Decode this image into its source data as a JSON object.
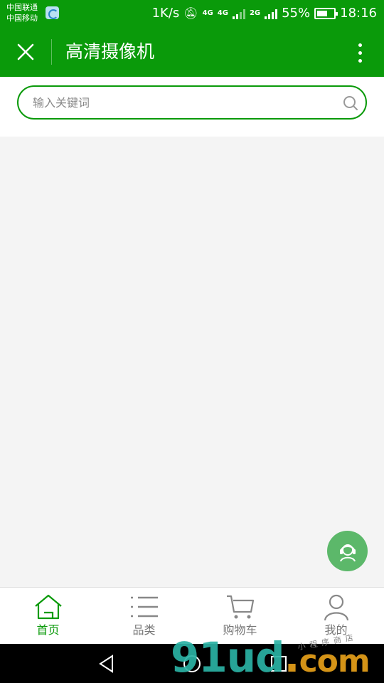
{
  "status_bar": {
    "carrier_1": "中国联通",
    "carrier_2": "中国移动",
    "speed": "1K/s",
    "network_1": "4G",
    "network_2": "4G",
    "network_3": "2G",
    "battery": "55%",
    "time": "18:16"
  },
  "header": {
    "title": "高清摄像机",
    "close_icon": "close-icon",
    "more_icon": "more-vertical-icon",
    "background": "#0a9a0a"
  },
  "search": {
    "placeholder": "输入关键词",
    "value": "",
    "icon": "search-icon"
  },
  "bottom_nav": {
    "items": [
      {
        "label": "首页",
        "icon": "home-icon",
        "active": true
      },
      {
        "label": "品类",
        "icon": "list-icon",
        "active": false
      },
      {
        "label": "购物车",
        "icon": "cart-icon",
        "active": false
      },
      {
        "label": "我的",
        "icon": "user-icon",
        "active": false
      }
    ],
    "active_color": "#0a9a0a",
    "inactive_color": "#777777"
  },
  "floating": {
    "icon": "customer-service-icon",
    "color": "#5cb86a"
  },
  "watermark": {
    "text": "91ud",
    "dot": ".",
    "suffix": "com",
    "sub": "小程序商店"
  }
}
